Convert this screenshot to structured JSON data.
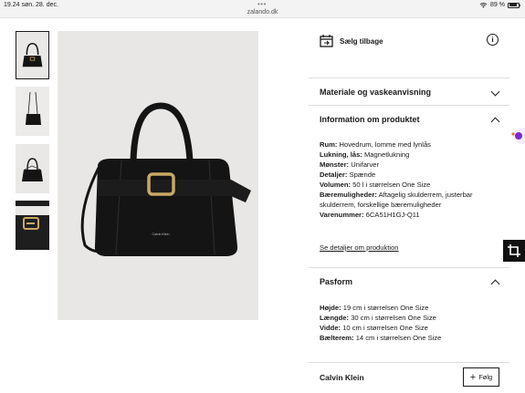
{
  "status_bar": {
    "time_date": "19.24  søn. 28. dec.",
    "url": "zalando.dk",
    "battery": "89 %",
    "battery_level": 0.89,
    "dots": "•••"
  },
  "gallery": {
    "thumbnails": [
      {
        "label": "bag-front-thumbnail",
        "selected": true
      },
      {
        "label": "bag-worn-thumbnail",
        "selected": false
      },
      {
        "label": "bag-open-thumbnail",
        "selected": false
      },
      {
        "label": "bag-buckle-detail-thumbnail",
        "selected": false
      }
    ],
    "main_image_logo": "Calvin Klein"
  },
  "sell_back": {
    "label": "Sælg tilbage",
    "icon": "calendar-return-icon",
    "info_icon": "i"
  },
  "accordions": {
    "material": {
      "title": "Materiale og vaskeanvisning",
      "expanded": false
    },
    "product_info": {
      "title": "Information om produktet",
      "expanded": true,
      "specs": [
        {
          "key": "Rum:",
          "value": "Hovedrum, lomme med lynlås"
        },
        {
          "key": "Lukning, lås:",
          "value": "Magnetlukning"
        },
        {
          "key": "Mønster:",
          "value": "Unifarver"
        },
        {
          "key": "Detaljer:",
          "value": "Spænde"
        },
        {
          "key": "Volumen:",
          "value": "50 l i størrelsen One Size"
        },
        {
          "key": "Bæremuligheder:",
          "value": "Aftagelig skulderrem, justerbar"
        },
        {
          "key": "",
          "value": "skulderrem, forskellige bæremuligheder"
        },
        {
          "key": "Varenummer:",
          "value": "6CA51H1GJ-Q11"
        }
      ],
      "link": "Se detaljer om produktion"
    },
    "fit": {
      "title": "Pasform",
      "expanded": true,
      "specs": [
        {
          "key": "Højde:",
          "value": "19 cm i størrelsen One Size"
        },
        {
          "key": "Længde:",
          "value": "30 cm i størrelsen One Size"
        },
        {
          "key": "Vidde:",
          "value": "10 cm i størrelsen One Size"
        },
        {
          "key": "Bælterem:",
          "value": "14 cm i størrelsen One Size"
        }
      ]
    }
  },
  "brand": {
    "name": "Calvin Klein",
    "follow_label": "Følg"
  },
  "colors": {
    "text": "#1a1a1a",
    "divider": "#dcdcdc",
    "image_bg": "#e8e7e5",
    "bag": "#141414",
    "buckle": "#c9a865",
    "chat_accent": "#7a2ccf"
  }
}
